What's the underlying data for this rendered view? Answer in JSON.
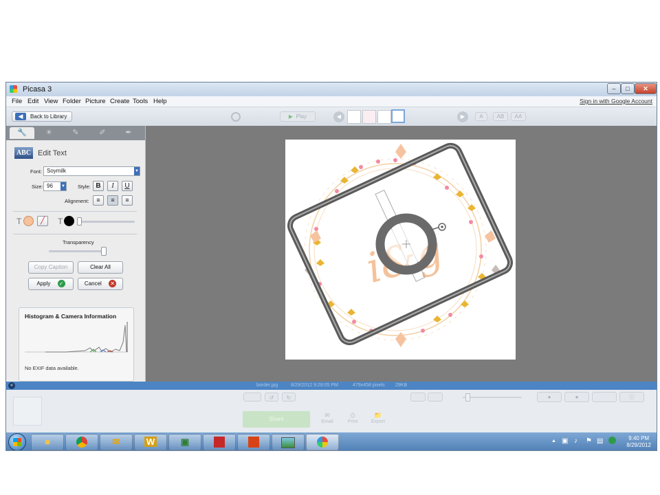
{
  "window": {
    "title": "Picasa 3"
  },
  "menu": [
    "File",
    "Edit",
    "View",
    "Folder",
    "Picture",
    "Create",
    "Tools",
    "Help"
  ],
  "signin": "Sign in with Google Account",
  "toolbar": {
    "back_label": "Back to Library",
    "play_label": "Play",
    "layout_labels": [
      "A",
      "AB",
      "AA"
    ]
  },
  "panel": {
    "header": "Edit Text",
    "abc_logo": "ABC",
    "font_label": "Font:",
    "font_value": "Soymilk",
    "size_label": "Size:",
    "size_value": "96",
    "style_label": "Style:",
    "style_buttons": [
      "B",
      "I",
      "U"
    ],
    "alignment_label": "Alignment:",
    "transparency_label": "Transparency",
    "copy_caption": "Copy Caption",
    "clear_all": "Clear All",
    "apply": "Apply",
    "cancel": "Cancel",
    "histogram_title": "Histogram & Camera Information",
    "exif": "No EXIF data available."
  },
  "statusbar": {
    "filename": "border.jpg",
    "date": "8/29/2012 9:28:05 PM",
    "dimensions": "479x458 pixels",
    "size": "29KB"
  },
  "bottom": {
    "share": "Share",
    "email": "Email",
    "print": "Print",
    "export": "Export"
  },
  "image_text": "i&g",
  "colors": {
    "text_color": "#f5c29a",
    "accent": "#4d85c4",
    "flower_pink": "#f08ba6",
    "flower_yellow": "#e9b533"
  },
  "taskbar": {
    "word": "W",
    "clock_time": "9:40 PM",
    "clock_date": "8/29/2012"
  }
}
